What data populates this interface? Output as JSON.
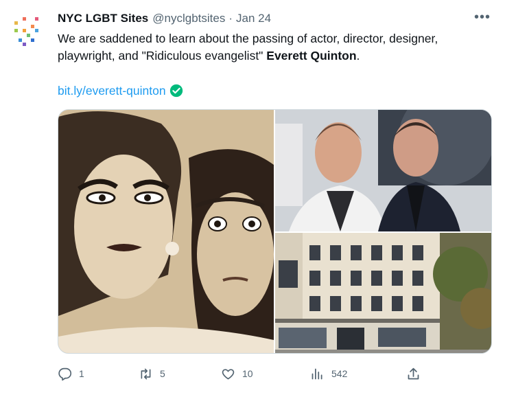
{
  "tweet": {
    "author_name": "NYC LGBT Sites",
    "handle": "@nyclgbtsites",
    "separator": "·",
    "date": "Jan 24",
    "more_label": "•••",
    "text_plain": "We are saddened to learn about the passing of actor, director, designer, playwright, and \"Ridiculous evangelist\"",
    "text_bold": "Everett Quinton",
    "text_end": ".",
    "link": "bit.ly/everett-quinton",
    "link_verified_icon": "check-badge-icon"
  },
  "media": {
    "images": [
      {
        "name": "sepia-portrait-photo"
      },
      {
        "name": "two-men-photo"
      },
      {
        "name": "building-photo"
      }
    ]
  },
  "actions": {
    "reply": {
      "count": "1",
      "icon": "reply-icon"
    },
    "retweet": {
      "count": "5",
      "icon": "retweet-icon"
    },
    "like": {
      "count": "10",
      "icon": "heart-icon"
    },
    "views": {
      "count": "542",
      "icon": "views-icon"
    },
    "share": {
      "icon": "share-icon"
    }
  },
  "colors": {
    "text": "#0f1419",
    "secondary": "#536471",
    "link": "#1d9bf0",
    "verified": "#00ba7c"
  }
}
